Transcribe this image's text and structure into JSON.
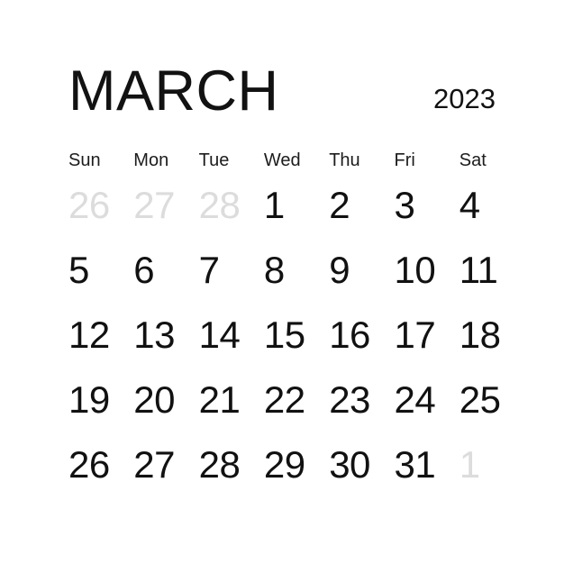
{
  "page": {
    "background_color": "#ffffff",
    "text_color": "#111111",
    "muted_color": "#dcdcdc"
  },
  "header": {
    "month": "MARCH",
    "year": "2023"
  },
  "weekdays": [
    {
      "label": "Sun"
    },
    {
      "label": "Mon"
    },
    {
      "label": "Tue"
    },
    {
      "label": "Wed"
    },
    {
      "label": "Thu"
    },
    {
      "label": "Fri"
    },
    {
      "label": "Sat"
    }
  ],
  "weeks": [
    [
      {
        "n": "26",
        "muted": true
      },
      {
        "n": "27",
        "muted": true
      },
      {
        "n": "28",
        "muted": true
      },
      {
        "n": "1",
        "muted": false
      },
      {
        "n": "2",
        "muted": false
      },
      {
        "n": "3",
        "muted": false
      },
      {
        "n": "4",
        "muted": false
      }
    ],
    [
      {
        "n": "5",
        "muted": false
      },
      {
        "n": "6",
        "muted": false
      },
      {
        "n": "7",
        "muted": false
      },
      {
        "n": "8",
        "muted": false
      },
      {
        "n": "9",
        "muted": false
      },
      {
        "n": "10",
        "muted": false
      },
      {
        "n": "11",
        "muted": false
      }
    ],
    [
      {
        "n": "12",
        "muted": false
      },
      {
        "n": "13",
        "muted": false
      },
      {
        "n": "14",
        "muted": false
      },
      {
        "n": "15",
        "muted": false
      },
      {
        "n": "16",
        "muted": false
      },
      {
        "n": "17",
        "muted": false
      },
      {
        "n": "18",
        "muted": false
      }
    ],
    [
      {
        "n": "19",
        "muted": false
      },
      {
        "n": "20",
        "muted": false
      },
      {
        "n": "21",
        "muted": false
      },
      {
        "n": "22",
        "muted": false
      },
      {
        "n": "23",
        "muted": false
      },
      {
        "n": "24",
        "muted": false
      },
      {
        "n": "25",
        "muted": false
      }
    ],
    [
      {
        "n": "26",
        "muted": false
      },
      {
        "n": "27",
        "muted": false
      },
      {
        "n": "28",
        "muted": false
      },
      {
        "n": "29",
        "muted": false
      },
      {
        "n": "30",
        "muted": false
      },
      {
        "n": "31",
        "muted": false
      },
      {
        "n": "1",
        "muted": true
      }
    ]
  ]
}
